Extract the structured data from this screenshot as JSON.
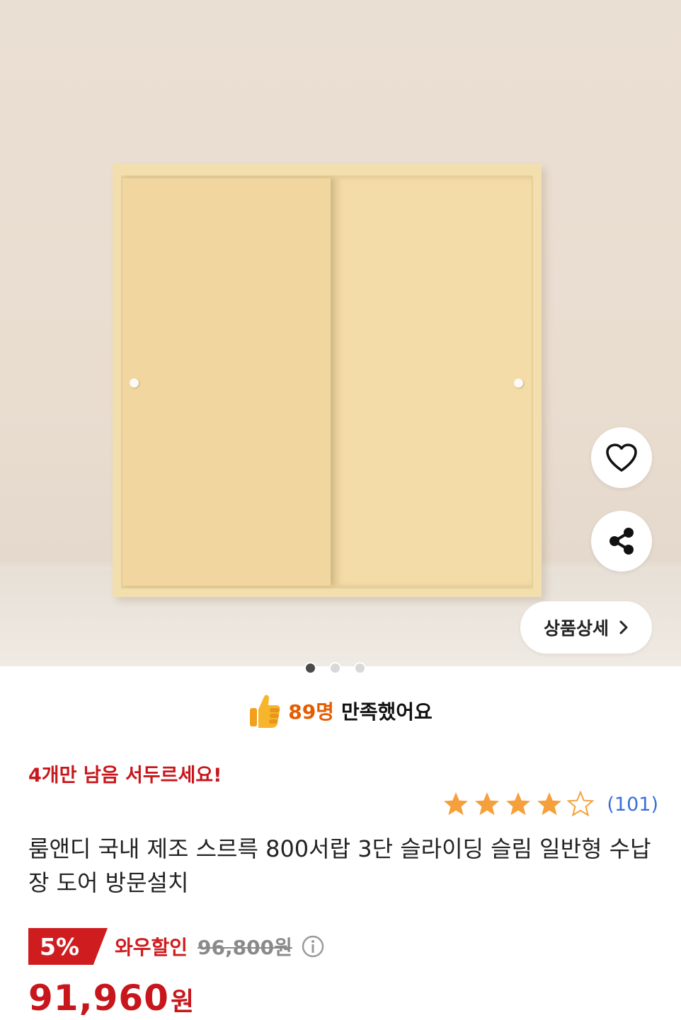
{
  "product_image": {
    "detail_button_label": "상품상세",
    "page_indicator": {
      "total": 3,
      "active": 1
    }
  },
  "satisfaction": {
    "count": "89명",
    "text": "만족했어요"
  },
  "stock_notice": "4개만 남음 서두르세요!",
  "rating": {
    "stars": 4.5,
    "count": "(101)"
  },
  "product_title": "룸앤디 국내 제조 스르륵 800서랍 3단 슬라이딩 슬림 일반형 수납장 도어 방문설치",
  "pricing": {
    "discount_badge": "5%",
    "discount_label": "와우할인",
    "original_price": "96,800원",
    "final_price": "91,960",
    "final_unit": "원"
  },
  "colors": {
    "accent_red": "#cf1c1f",
    "satisfaction_orange": "#e55c00",
    "star": "#f5a03a",
    "link_blue": "#3a6fd8"
  }
}
